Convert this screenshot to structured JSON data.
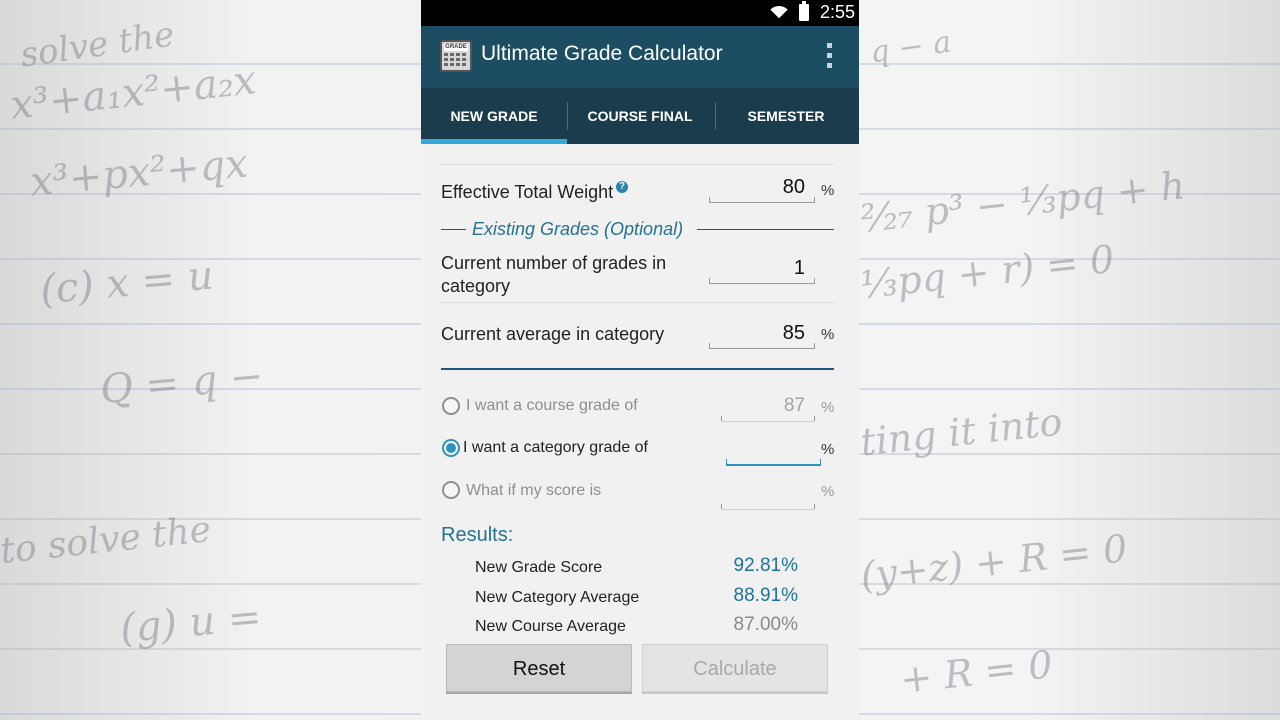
{
  "status_bar": {
    "time": "2:55"
  },
  "action_bar": {
    "title": "Ultimate Grade Calculator",
    "icon_text": "GRADE"
  },
  "tabs": [
    {
      "label": "NEW GRADE",
      "selected": true
    },
    {
      "label": "COURSE FINAL",
      "selected": false
    },
    {
      "label": "SEMESTER",
      "selected": false
    }
  ],
  "form": {
    "effective_total_weight": {
      "label": "Effective Total Weight",
      "help": "?",
      "value": "80",
      "unit": "%"
    },
    "existing_grades_header": "Existing Grades (Optional)",
    "current_num_grades": {
      "label": "Current number of grades in category",
      "value": "1"
    },
    "current_average": {
      "label": "Current average in category",
      "value": "85",
      "unit": "%"
    }
  },
  "options": [
    {
      "label": "I want a course grade of",
      "value": "87",
      "unit": "%",
      "selected": false
    },
    {
      "label": "I want a category grade of",
      "value": "",
      "unit": "%",
      "selected": true
    },
    {
      "label": "What if my score is",
      "value": "",
      "unit": "%",
      "selected": false
    }
  ],
  "results": {
    "heading": "Results:",
    "rows": [
      {
        "name": "New Grade Score",
        "value": "92.81%"
      },
      {
        "name": "New Category Average",
        "value": "88.91%"
      },
      {
        "name": "New Course Average",
        "value": "87.00%"
      }
    ]
  },
  "buttons": {
    "reset": "Reset",
    "calculate": "Calculate"
  },
  "colors": {
    "action_bar": "#1d4d63",
    "tab_bar": "#1a3c4c",
    "accent": "#34a9d6",
    "result_value": "#1e7398"
  }
}
